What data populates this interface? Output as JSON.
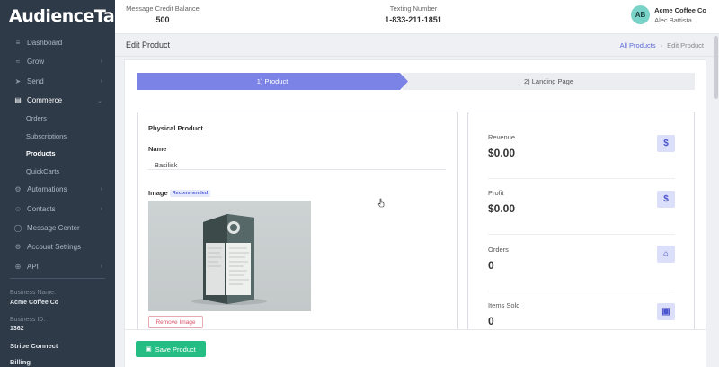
{
  "sidebar": {
    "logo": "AudienceTap",
    "nav": [
      {
        "label": "Dashboard",
        "icon": "chart-icon",
        "glyph": "≡"
      },
      {
        "label": "Grow",
        "icon": "grow-icon",
        "glyph": "≈",
        "chevron": "›"
      },
      {
        "label": "Send",
        "icon": "send-icon",
        "glyph": "➤",
        "chevron": "›"
      },
      {
        "label": "Commerce",
        "icon": "store-icon",
        "glyph": "▤",
        "chevron": "⌄"
      }
    ],
    "commerce_sub": [
      "Orders",
      "Subscriptions",
      "Products",
      "QuickCarts"
    ],
    "nav2": [
      {
        "label": "Automations",
        "icon": "automation-icon",
        "glyph": "⚙",
        "chevron": "›"
      },
      {
        "label": "Contacts",
        "icon": "contacts-icon",
        "glyph": "☺",
        "chevron": "›"
      },
      {
        "label": "Message Center",
        "icon": "message-icon",
        "glyph": "◯"
      },
      {
        "label": "Account Settings",
        "icon": "settings-icon",
        "glyph": "⚙"
      },
      {
        "label": "API",
        "icon": "api-icon",
        "glyph": "⊕",
        "chevron": "›"
      }
    ],
    "business_name_label": "Business Name:",
    "business_name": "Acme Coffee Co",
    "business_id_label": "Business ID:",
    "business_id": "1362",
    "stripe": "Stripe Connect",
    "billing": "Billing"
  },
  "header": {
    "credit_label": "Message Credit Balance",
    "credit_value": "500",
    "texting_label": "Texting Number",
    "texting_value": "1-833-211-1851",
    "avatar_initials": "AB",
    "user_business": "Acme Coffee Co",
    "user_name": "Alec Battista"
  },
  "page": {
    "title": "Edit Product",
    "breadcrumb_link": "All Products",
    "breadcrumb_sep": "›",
    "breadcrumb_current": "Edit Product"
  },
  "steps": {
    "step1": "1) Product",
    "step2": "2) Landing Page"
  },
  "product": {
    "type_title": "Physical Product",
    "name_label": "Name",
    "name_value": "Basilisk",
    "image_label": "Image",
    "image_badge": "Recommended",
    "remove_image": "Remove Image"
  },
  "stats": [
    {
      "label": "Revenue",
      "value": "$0.00",
      "icon": "dollar-icon",
      "glyph": "$"
    },
    {
      "label": "Profit",
      "value": "$0.00",
      "icon": "dollar-icon",
      "glyph": "$"
    },
    {
      "label": "Orders",
      "value": "0",
      "icon": "cart-icon",
      "glyph": "⌂"
    },
    {
      "label": "Items Sold",
      "value": "0",
      "icon": "gift-icon",
      "glyph": "▣"
    }
  ],
  "footer": {
    "save_label": "Save Product",
    "save_icon": "save-icon"
  },
  "colors": {
    "sidebar": "#2f3a48",
    "accent": "#7c83e6",
    "save": "#24bd84",
    "danger": "#d9536a"
  }
}
